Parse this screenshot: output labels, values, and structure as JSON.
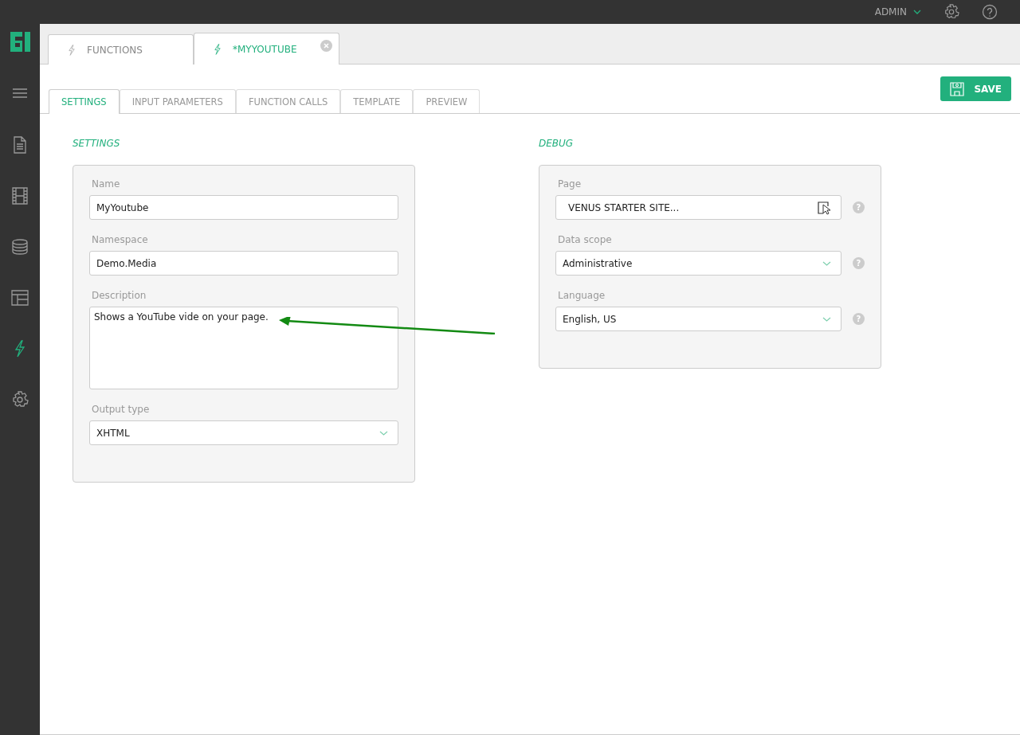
{
  "top_bar": {
    "user": "ADMIN"
  },
  "sidebar": {
    "items": [
      {
        "kind": "menu",
        "selected": false
      },
      {
        "kind": "page",
        "selected": false
      },
      {
        "kind": "media",
        "selected": false
      },
      {
        "kind": "data",
        "selected": false
      },
      {
        "kind": "layout",
        "selected": false
      },
      {
        "kind": "function",
        "selected": true
      },
      {
        "kind": "settings",
        "selected": false
      }
    ]
  },
  "document_tabs": [
    {
      "label": "FUNCTIONS",
      "selected": false,
      "closable": false
    },
    {
      "label": "*MYYOUTUBE",
      "selected": true,
      "closable": true
    }
  ],
  "view_tabs": [
    {
      "label": "SETTINGS",
      "selected": true
    },
    {
      "label": "INPUT PARAMETERS",
      "selected": false
    },
    {
      "label": "FUNCTION CALLS",
      "selected": false
    },
    {
      "label": "TEMPLATE",
      "selected": false
    },
    {
      "label": "PREVIEW",
      "selected": false
    }
  ],
  "save_button": {
    "label": "SAVE"
  },
  "sections": [
    {
      "title": "SETTINGS",
      "fields": [
        {
          "kind": "text",
          "label": "Name",
          "value": "MyYoutube"
        },
        {
          "kind": "text",
          "label": "Namespace",
          "value": "Demo.Media"
        },
        {
          "kind": "textarea",
          "label": "Description",
          "value": "Shows a YouTube vide on your page."
        },
        {
          "kind": "select",
          "label": "Output type",
          "value": "XHTML"
        }
      ]
    },
    {
      "title": "DEBUG",
      "fields": [
        {
          "kind": "picker",
          "label": "Page",
          "value": "VENUS STARTER SITE...",
          "help": "?"
        },
        {
          "kind": "select",
          "label": "Data scope",
          "value": "Administrative",
          "help": "?"
        },
        {
          "kind": "select",
          "label": "Language",
          "value": "English, US",
          "help": "?"
        }
      ]
    }
  ]
}
